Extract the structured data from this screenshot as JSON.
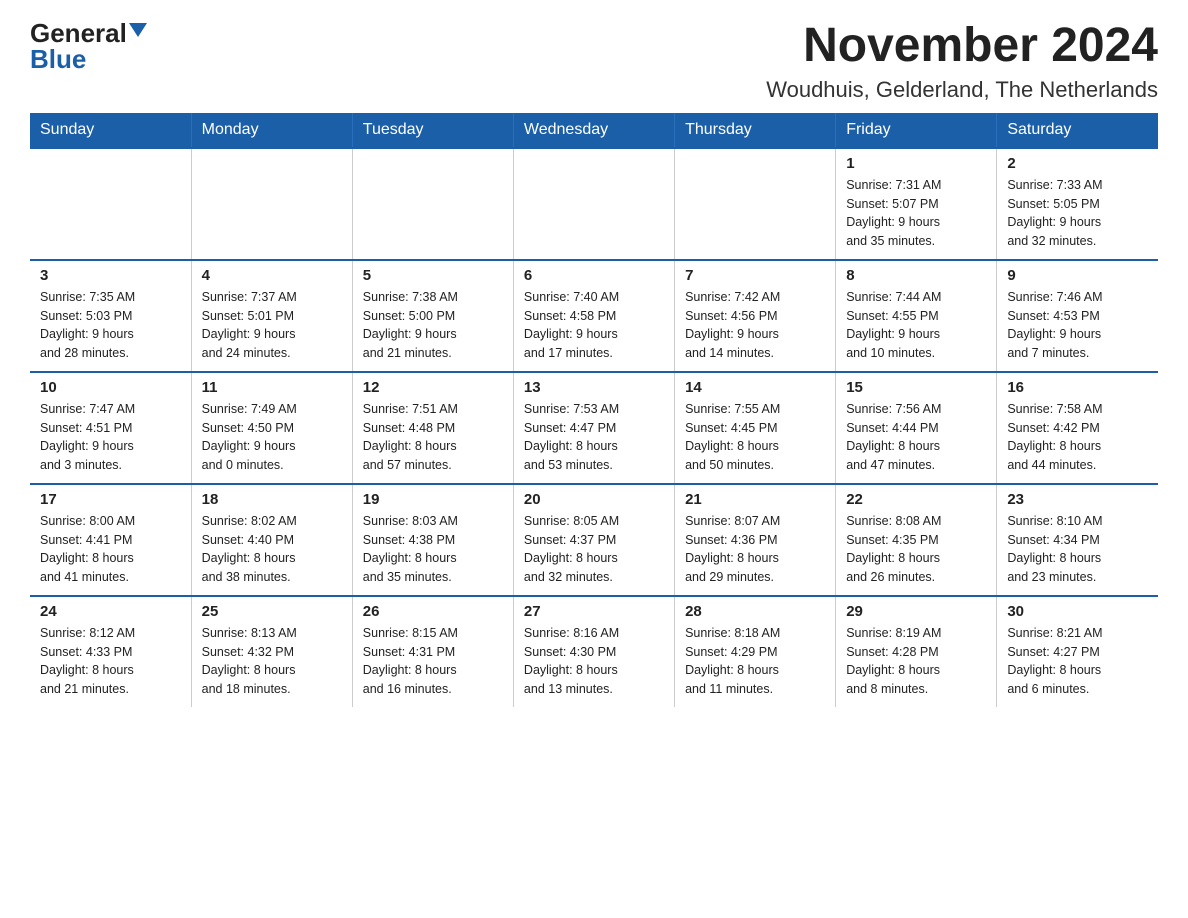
{
  "logo": {
    "general": "General",
    "blue": "Blue"
  },
  "title": "November 2024",
  "subtitle": "Woudhuis, Gelderland, The Netherlands",
  "weekdays": [
    "Sunday",
    "Monday",
    "Tuesday",
    "Wednesday",
    "Thursday",
    "Friday",
    "Saturday"
  ],
  "weeks": [
    [
      {
        "day": "",
        "info": ""
      },
      {
        "day": "",
        "info": ""
      },
      {
        "day": "",
        "info": ""
      },
      {
        "day": "",
        "info": ""
      },
      {
        "day": "",
        "info": ""
      },
      {
        "day": "1",
        "info": "Sunrise: 7:31 AM\nSunset: 5:07 PM\nDaylight: 9 hours\nand 35 minutes."
      },
      {
        "day": "2",
        "info": "Sunrise: 7:33 AM\nSunset: 5:05 PM\nDaylight: 9 hours\nand 32 minutes."
      }
    ],
    [
      {
        "day": "3",
        "info": "Sunrise: 7:35 AM\nSunset: 5:03 PM\nDaylight: 9 hours\nand 28 minutes."
      },
      {
        "day": "4",
        "info": "Sunrise: 7:37 AM\nSunset: 5:01 PM\nDaylight: 9 hours\nand 24 minutes."
      },
      {
        "day": "5",
        "info": "Sunrise: 7:38 AM\nSunset: 5:00 PM\nDaylight: 9 hours\nand 21 minutes."
      },
      {
        "day": "6",
        "info": "Sunrise: 7:40 AM\nSunset: 4:58 PM\nDaylight: 9 hours\nand 17 minutes."
      },
      {
        "day": "7",
        "info": "Sunrise: 7:42 AM\nSunset: 4:56 PM\nDaylight: 9 hours\nand 14 minutes."
      },
      {
        "day": "8",
        "info": "Sunrise: 7:44 AM\nSunset: 4:55 PM\nDaylight: 9 hours\nand 10 minutes."
      },
      {
        "day": "9",
        "info": "Sunrise: 7:46 AM\nSunset: 4:53 PM\nDaylight: 9 hours\nand 7 minutes."
      }
    ],
    [
      {
        "day": "10",
        "info": "Sunrise: 7:47 AM\nSunset: 4:51 PM\nDaylight: 9 hours\nand 3 minutes."
      },
      {
        "day": "11",
        "info": "Sunrise: 7:49 AM\nSunset: 4:50 PM\nDaylight: 9 hours\nand 0 minutes."
      },
      {
        "day": "12",
        "info": "Sunrise: 7:51 AM\nSunset: 4:48 PM\nDaylight: 8 hours\nand 57 minutes."
      },
      {
        "day": "13",
        "info": "Sunrise: 7:53 AM\nSunset: 4:47 PM\nDaylight: 8 hours\nand 53 minutes."
      },
      {
        "day": "14",
        "info": "Sunrise: 7:55 AM\nSunset: 4:45 PM\nDaylight: 8 hours\nand 50 minutes."
      },
      {
        "day": "15",
        "info": "Sunrise: 7:56 AM\nSunset: 4:44 PM\nDaylight: 8 hours\nand 47 minutes."
      },
      {
        "day": "16",
        "info": "Sunrise: 7:58 AM\nSunset: 4:42 PM\nDaylight: 8 hours\nand 44 minutes."
      }
    ],
    [
      {
        "day": "17",
        "info": "Sunrise: 8:00 AM\nSunset: 4:41 PM\nDaylight: 8 hours\nand 41 minutes."
      },
      {
        "day": "18",
        "info": "Sunrise: 8:02 AM\nSunset: 4:40 PM\nDaylight: 8 hours\nand 38 minutes."
      },
      {
        "day": "19",
        "info": "Sunrise: 8:03 AM\nSunset: 4:38 PM\nDaylight: 8 hours\nand 35 minutes."
      },
      {
        "day": "20",
        "info": "Sunrise: 8:05 AM\nSunset: 4:37 PM\nDaylight: 8 hours\nand 32 minutes."
      },
      {
        "day": "21",
        "info": "Sunrise: 8:07 AM\nSunset: 4:36 PM\nDaylight: 8 hours\nand 29 minutes."
      },
      {
        "day": "22",
        "info": "Sunrise: 8:08 AM\nSunset: 4:35 PM\nDaylight: 8 hours\nand 26 minutes."
      },
      {
        "day": "23",
        "info": "Sunrise: 8:10 AM\nSunset: 4:34 PM\nDaylight: 8 hours\nand 23 minutes."
      }
    ],
    [
      {
        "day": "24",
        "info": "Sunrise: 8:12 AM\nSunset: 4:33 PM\nDaylight: 8 hours\nand 21 minutes."
      },
      {
        "day": "25",
        "info": "Sunrise: 8:13 AM\nSunset: 4:32 PM\nDaylight: 8 hours\nand 18 minutes."
      },
      {
        "day": "26",
        "info": "Sunrise: 8:15 AM\nSunset: 4:31 PM\nDaylight: 8 hours\nand 16 minutes."
      },
      {
        "day": "27",
        "info": "Sunrise: 8:16 AM\nSunset: 4:30 PM\nDaylight: 8 hours\nand 13 minutes."
      },
      {
        "day": "28",
        "info": "Sunrise: 8:18 AM\nSunset: 4:29 PM\nDaylight: 8 hours\nand 11 minutes."
      },
      {
        "day": "29",
        "info": "Sunrise: 8:19 AM\nSunset: 4:28 PM\nDaylight: 8 hours\nand 8 minutes."
      },
      {
        "day": "30",
        "info": "Sunrise: 8:21 AM\nSunset: 4:27 PM\nDaylight: 8 hours\nand 6 minutes."
      }
    ]
  ]
}
